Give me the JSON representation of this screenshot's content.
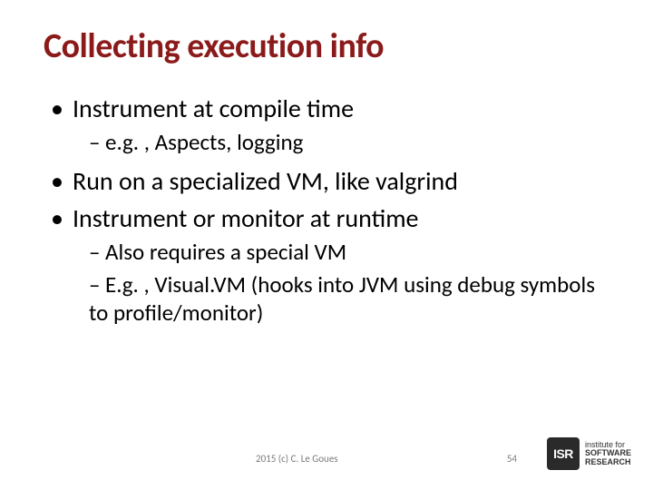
{
  "title": "Collecting execution info",
  "bullets": {
    "b1": "Instrument at compile time",
    "b1a": "e.g. , Aspects, logging",
    "b2": "Run on a specialized VM, like valgrind",
    "b3": "Instrument or monitor at runtime",
    "b3a": "Also requires a special VM",
    "b3b": "E.g. , Visual.VM (hooks into JVM using debug symbols to profile/monitor)"
  },
  "footer": {
    "copyright": "2015 (c) C. Le Goues",
    "page": "54",
    "logo_abbr": "ISR",
    "logo_line1": "institute for",
    "logo_line2": "SOFTWARE",
    "logo_line3": "RESEARCH"
  }
}
